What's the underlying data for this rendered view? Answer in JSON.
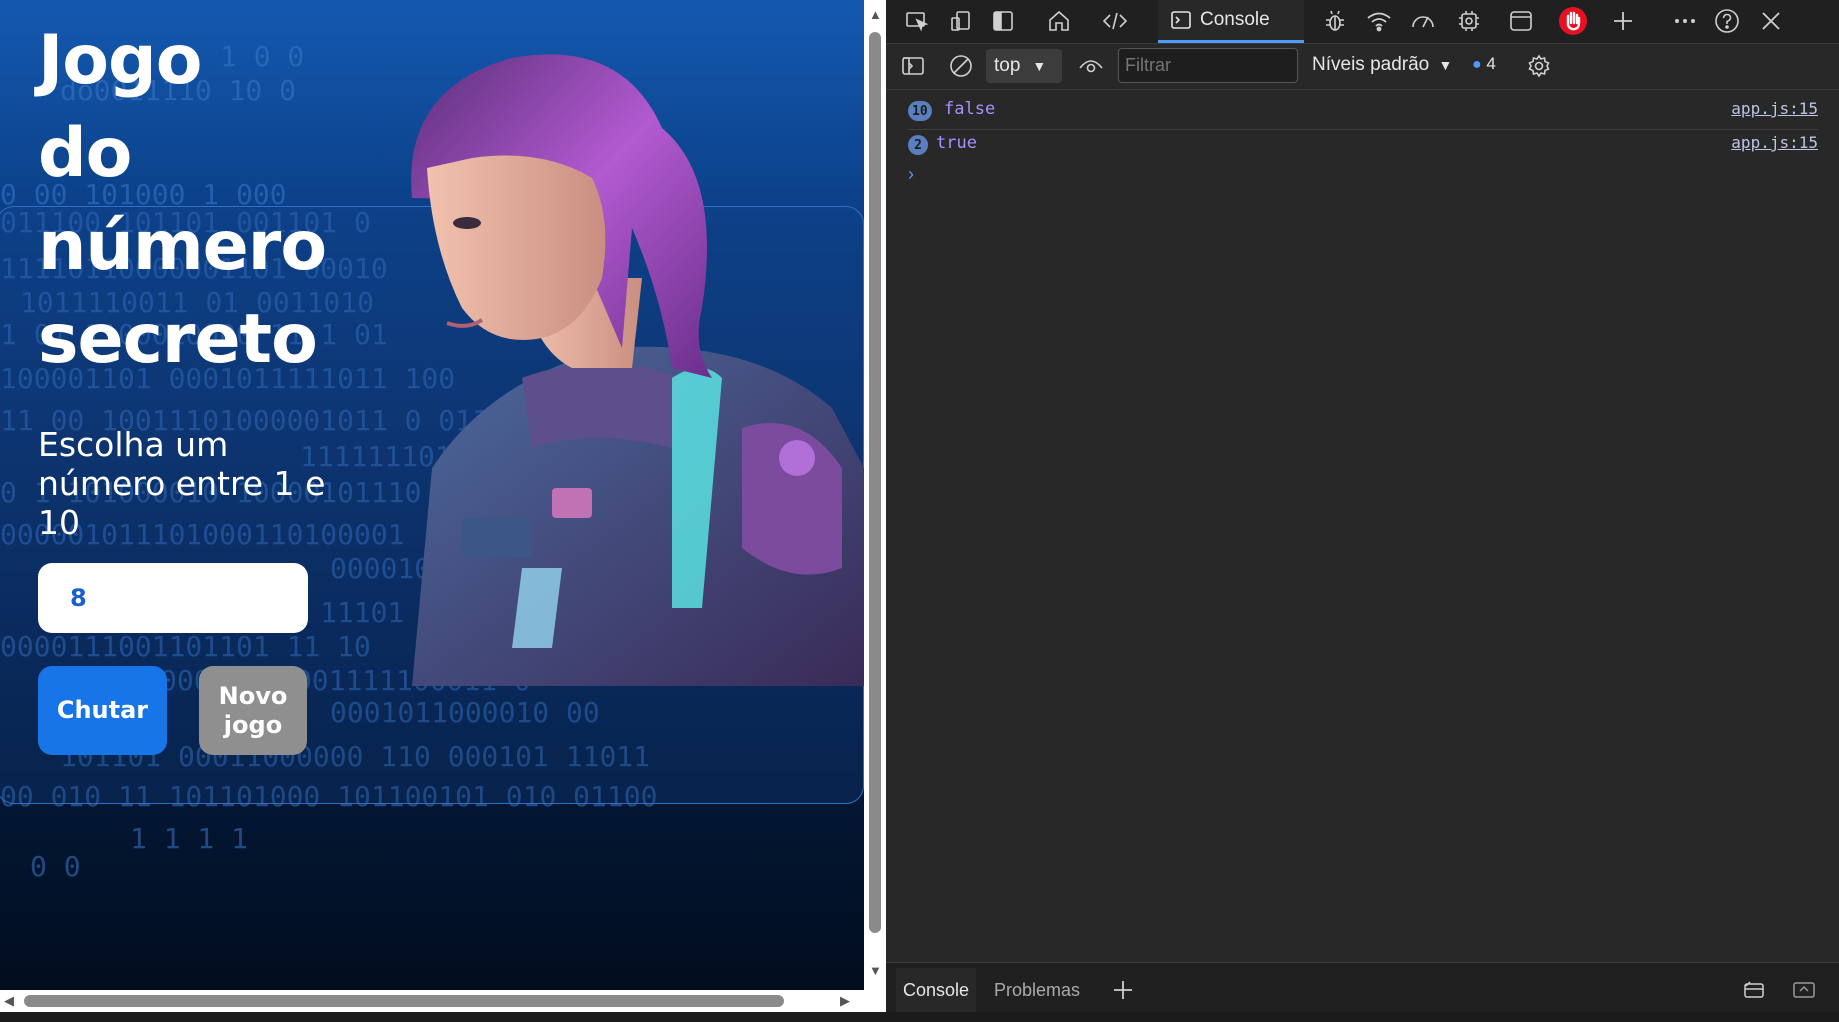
{
  "game": {
    "title_lines": [
      "Jogo",
      "do",
      "número",
      "secreto"
    ],
    "subtitle": "Escolha um número entre 1 e 10",
    "input_value": "8",
    "guess_button": "Chutar",
    "new_game_button": "Novo jogo",
    "background_digits": [
      "1  0  0",
      "do0011110 10 0",
      "0 00 101000 1  000",
      "011100 101101 001101 0",
      "11110110000001101 00010",
      "1011110011 01 0011010",
      "1 01 1100010000 11 1 01",
      "100001101 0001011111011 100",
      "11 00 10011101000001011 0 011",
      "1111111010",
      "0  1 101000010 10000101110",
      "000001011101000110100001",
      "0000101",
      "11101",
      "0000111001101101 11 10",
      "00011000001111100011 0",
      "0001011000010 00",
      "101101  00011000000 110 000101 11011",
      "00 010 11 101101000 101100101 010 01100",
      "1  1  1   1",
      "0   0"
    ]
  },
  "devtools": {
    "context": "top",
    "filter_placeholder": "Filtrar",
    "levels": "Níveis padrão",
    "message_count": "4",
    "console_tab": "Console",
    "logs": [
      {
        "count": "10",
        "value": "false",
        "source": "app.js:15"
      },
      {
        "count": "2",
        "value": "true",
        "source": "app.js:15"
      }
    ],
    "bottom_tabs": [
      "Console",
      "Problemas"
    ],
    "colors": {
      "accent": "#4d9bff",
      "stop_red": "#e81123",
      "log_value": "#a990ff"
    }
  }
}
